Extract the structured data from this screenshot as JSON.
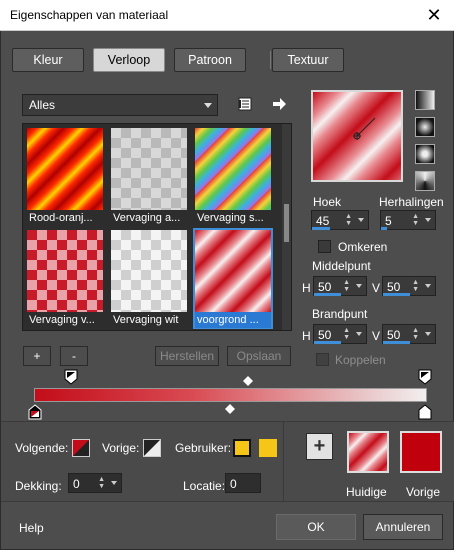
{
  "window": {
    "title": "Eigenschappen van materiaal",
    "close_label": "✕"
  },
  "tabs": [
    {
      "label": "Kleur"
    },
    {
      "label": "Verloop"
    },
    {
      "label": "Patroon"
    },
    {
      "label": "Textuur"
    }
  ],
  "category_select": {
    "value": "Alles"
  },
  "gallery": {
    "items": [
      {
        "label": "Rood-oranj..."
      },
      {
        "label": "Vervaging a..."
      },
      {
        "label": "Vervaging s..."
      },
      {
        "label": "Vervaging v..."
      },
      {
        "label": "Vervaging wit"
      },
      {
        "label": "voorgrond ..."
      }
    ]
  },
  "properties": {
    "angle_label": "Hoek",
    "angle_value": "45",
    "repeats_label": "Herhalingen",
    "repeats_value": "5",
    "invert_label": "Omkeren",
    "center_label": "Middelpunt",
    "center_h_label": "H",
    "center_h": "50",
    "center_v_label": "V",
    "center_v": "50",
    "focal_label": "Brandpunt",
    "focal_h_label": "H",
    "focal_h": "50",
    "focal_v_label": "V",
    "focal_v": "50",
    "link_label": "Koppelen"
  },
  "actions": {
    "add_label": "+",
    "remove_label": "-",
    "restore_label": "Herstellen",
    "save_label": "Opslaan"
  },
  "stops": {
    "next_label": "Volgende:",
    "prev_label": "Vorige:",
    "user_label": "Gebruiker:",
    "opacity_label": "Dekking:",
    "opacity_value": "0",
    "location_label": "Locatie:",
    "location_value": "0"
  },
  "colors": {
    "current_label": "Huidige",
    "previous_label": "Vorige",
    "add_label": "+",
    "previous_color": "#c0000d",
    "user_color": "#f5c518"
  },
  "footer": {
    "help_label": "Help",
    "ok_label": "OK",
    "cancel_label": "Annuleren"
  }
}
